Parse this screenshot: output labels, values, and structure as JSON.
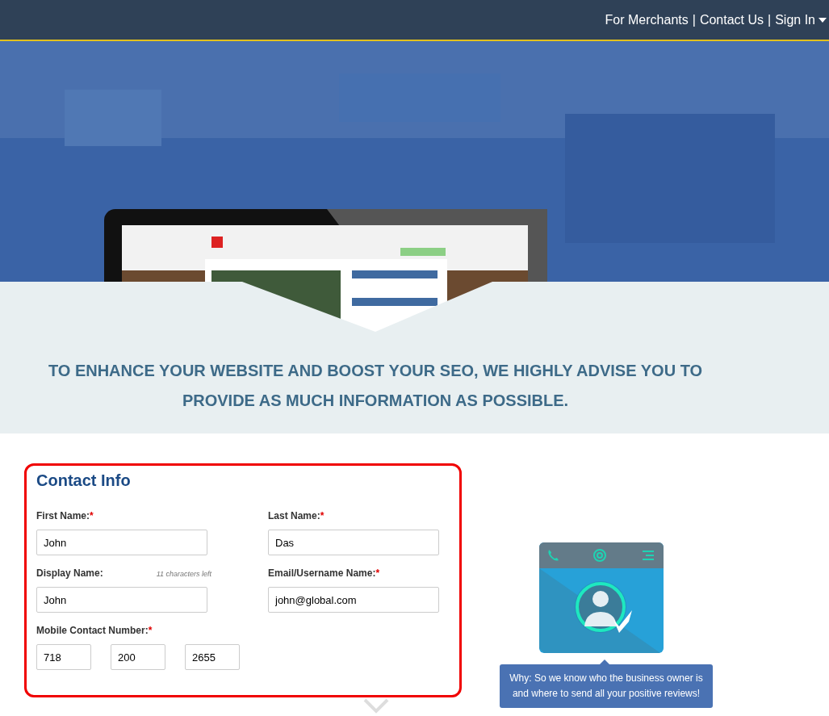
{
  "header": {
    "links": [
      {
        "label": "For Merchants"
      },
      {
        "label": "Contact Us"
      },
      {
        "label": "Sign In",
        "menu": true
      }
    ],
    "separator": "|"
  },
  "banner": {
    "heading": "TO ENHANCE YOUR WEBSITE AND BOOST YOUR SEO, WE HIGHLY ADVISE YOU TO PROVIDE AS MUCH INFORMATION AS POSSIBLE."
  },
  "contact_form": {
    "title": "Contact Info",
    "required_mark": "*",
    "fields": [
      {
        "kind": "text",
        "label": "First Name:",
        "required": true,
        "value": "John"
      },
      {
        "kind": "text",
        "label": "Last Name:",
        "required": true,
        "value": "Das"
      },
      {
        "kind": "text",
        "label": "Display Name:",
        "required": false,
        "hint": "11 characters left",
        "value": "John"
      },
      {
        "kind": "text",
        "label": "Email/Username Name:",
        "required": true,
        "value": "john@global.com"
      },
      {
        "kind": "phone",
        "label": "Mobile Contact Number:",
        "required": true,
        "parts": [
          "718",
          "200",
          "2655"
        ]
      }
    ]
  },
  "why_tooltip": {
    "text": "Why: So we know who the business owner is and where to send all your positive reviews!"
  }
}
